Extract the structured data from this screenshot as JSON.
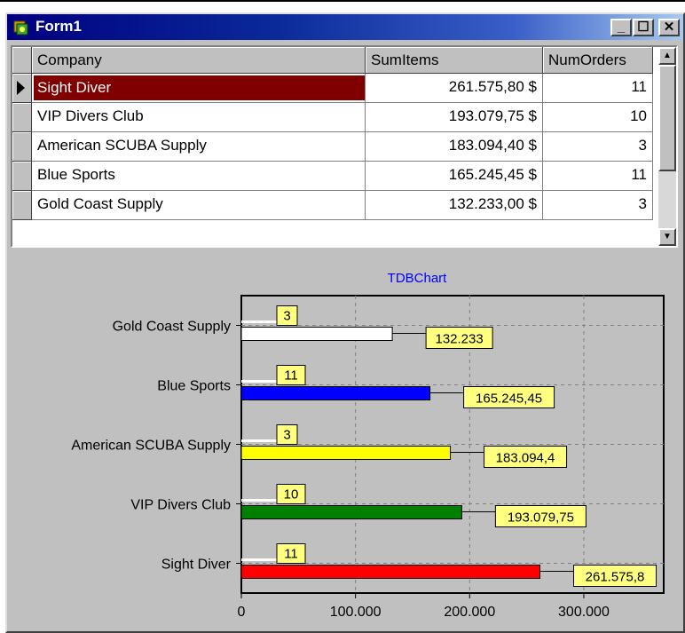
{
  "window": {
    "title": "Form1"
  },
  "grid": {
    "columns": [
      "Company",
      "SumItems",
      "NumOrders"
    ],
    "rows": [
      {
        "company": "Sight Diver",
        "sum": "261.575,80 $",
        "orders": "11"
      },
      {
        "company": "VIP Divers Club",
        "sum": "193.079,75 $",
        "orders": "10"
      },
      {
        "company": "American SCUBA Supply",
        "sum": "183.094,40 $",
        "orders": "3"
      },
      {
        "company": "Blue Sports",
        "sum": "165.245,45 $",
        "orders": "11"
      },
      {
        "company": "Gold Coast Supply",
        "sum": "132.233,00 $",
        "orders": "3"
      }
    ],
    "selected_index": 0
  },
  "chart_data": {
    "type": "bar",
    "title": "TDBChart",
    "orientation": "horizontal",
    "categories": [
      "Gold Coast Supply",
      "Blue Sports",
      "American SCUBA Supply",
      "VIP Divers Club",
      "Sight Diver"
    ],
    "series": [
      {
        "values": [
          132233,
          165245.45,
          183094.4,
          193079.75,
          261575.8
        ],
        "labels": [
          "132.233",
          "165.245,45",
          "183.094,4",
          "193.079,75",
          "261.575,8"
        ],
        "colors": [
          "#ffffff",
          "#0000ff",
          "#ffff00",
          "#008000",
          "#ff0000"
        ]
      },
      {
        "values": [
          3,
          11,
          3,
          10,
          11
        ],
        "labels": [
          "3",
          "11",
          "3",
          "10",
          "11"
        ]
      }
    ],
    "x_ticks": [
      "0",
      "100.000",
      "200.000",
      "300.000"
    ],
    "x_tick_values": [
      0,
      100000,
      200000,
      300000
    ],
    "xlim": [
      0,
      370000
    ],
    "grid": true,
    "legend": "none",
    "colors": {
      "title": "#0000ff",
      "mark_fill": "#ffff80"
    }
  }
}
